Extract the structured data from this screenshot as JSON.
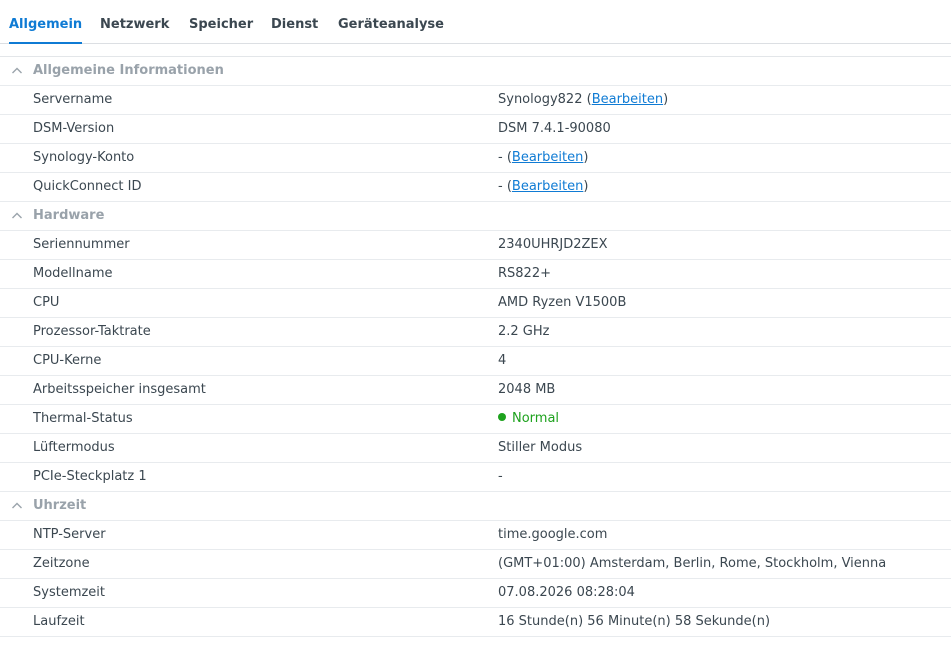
{
  "tabs": [
    {
      "label": "Allgemein",
      "active": true
    },
    {
      "label": "Netzwerk"
    },
    {
      "label": "Speicher"
    },
    {
      "label": "Dienst"
    },
    {
      "label": "Geräteanalyse"
    }
  ],
  "sections": {
    "general": {
      "title": "Allgemeine Informationen",
      "servername": {
        "label": "Servername",
        "value": "Synology822",
        "edit": "Bearbeiten"
      },
      "dsm": {
        "label": "DSM-Version",
        "value": "DSM 7.4.1-90080"
      },
      "account": {
        "label": "Synology-Konto",
        "value": "-",
        "edit": "Bearbeiten"
      },
      "quickconnect": {
        "label": "QuickConnect ID",
        "value": "-",
        "edit": "Bearbeiten"
      }
    },
    "hardware": {
      "title": "Hardware",
      "serial": {
        "label": "Seriennummer",
        "value": "2340UHRJD2ZEX"
      },
      "model": {
        "label": "Modellname",
        "value": "RS822+"
      },
      "cpu": {
        "label": "CPU",
        "value": "AMD Ryzen V1500B"
      },
      "clock": {
        "label": "Prozessor-Taktrate",
        "value": "2.2 GHz"
      },
      "cores": {
        "label": "CPU-Kerne",
        "value": "4"
      },
      "memory": {
        "label": "Arbeitsspeicher insgesamt",
        "value": "2048 MB"
      },
      "thermal": {
        "label": "Thermal-Status",
        "value": "Normal",
        "color": "#1ea21e"
      },
      "fan": {
        "label": "Lüftermodus",
        "value": "Stiller Modus"
      },
      "pcie": {
        "label": "PCIe-Steckplatz 1",
        "value": "-"
      }
    },
    "time": {
      "title": "Uhrzeit",
      "ntp": {
        "label": "NTP-Server",
        "value": "time.google.com"
      },
      "timezone": {
        "label": "Zeitzone",
        "value": "(GMT+01:00) Amsterdam, Berlin, Rome, Stockholm, Vienna"
      },
      "systemtime": {
        "label": "Systemzeit",
        "value": "07.08.2026 08:28:04"
      },
      "uptime": {
        "label": "Laufzeit",
        "value": "16 Stunde(n) 56 Minute(n) 58 Sekunde(n)"
      }
    }
  }
}
